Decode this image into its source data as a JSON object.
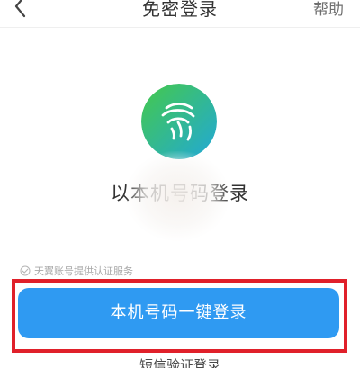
{
  "header": {
    "title": "免密登录",
    "help_label": "帮助",
    "back_icon": "chevron-left-icon"
  },
  "logo": {
    "icon": "fingerprint-logo-icon",
    "colors": [
      "#45c94a",
      "#21a8d8"
    ]
  },
  "login": {
    "masked_number": "以本机号码登录",
    "service_text": "天翼账号提供认证服务",
    "primary_button": "本机号码一键登录",
    "sms_link": "短信验证登录"
  },
  "colors": {
    "button": "#2f9af2",
    "highlight": "#e0202a"
  }
}
